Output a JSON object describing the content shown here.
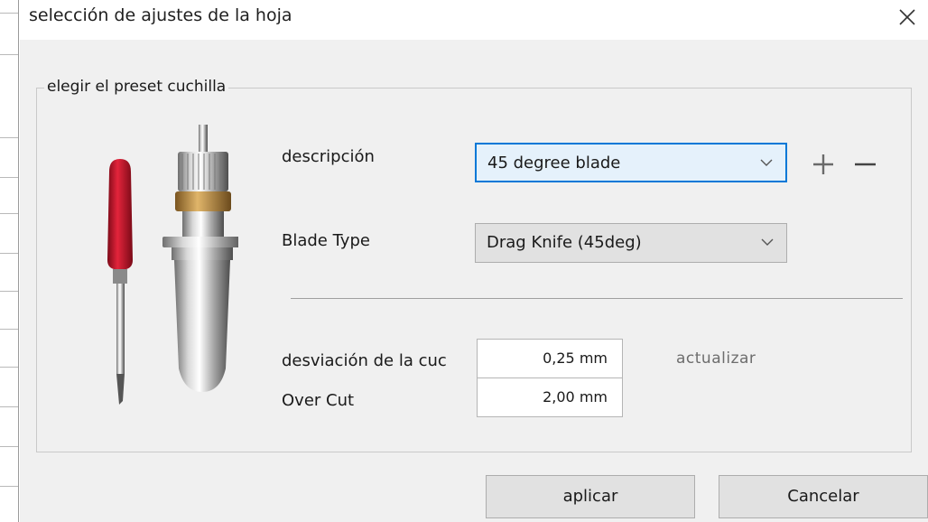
{
  "dialog": {
    "title": "selección de ajustes de la hoja",
    "close_icon": "close-icon"
  },
  "group": {
    "label": "elegir el preset cuchilla",
    "illustration": "blade-holder-image"
  },
  "fields": {
    "description_label": "descripción",
    "description_value": "45 degree blade",
    "blade_type_label": "Blade Type",
    "blade_type_value": "Drag Knife (45deg)",
    "offset_label": "desviación de la cuc",
    "offset_value": "0,25 mm",
    "overcut_label": "Over Cut",
    "overcut_value": "2,00 mm",
    "update_label": "actualizar"
  },
  "icons": {
    "add": "plus-icon",
    "remove": "minus-icon",
    "dropdown": "chevron-down-icon"
  },
  "buttons": {
    "apply": "aplicar",
    "cancel": "Cancelar"
  },
  "colors": {
    "focus_border": "#0078d7",
    "focus_fill": "#e5f1fb",
    "dialog_bg": "#f0f0f0",
    "button_bg": "#e1e1e1",
    "blade_cap": "#c8102e",
    "brass_ring": "#b8863b"
  }
}
